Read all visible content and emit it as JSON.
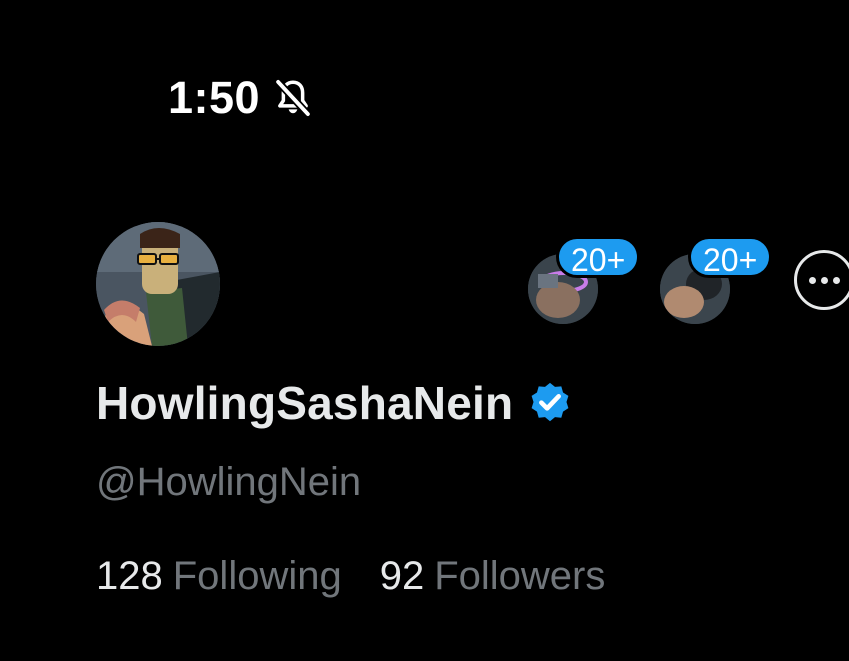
{
  "status_bar": {
    "time": "1:50",
    "silent_icon": "bell-slash-icon"
  },
  "profile": {
    "avatar_icon": "profile-avatar",
    "display_name": "HowlingSashaNein",
    "verified_icon": "verified-badge-icon",
    "verified_color": "#1d9bf0",
    "handle": "@HowlingNein",
    "following_count": "128",
    "following_label": "Following",
    "followers_count": "92",
    "followers_label": "Followers"
  },
  "spaces": [
    {
      "badge": "20+"
    },
    {
      "badge": "20+"
    }
  ],
  "more_button_icon": "more-horizontal-icon",
  "colors": {
    "background": "#000000",
    "primary_text": "#e7e9ea",
    "secondary_text": "#71767b",
    "accent": "#1d9bf0"
  }
}
